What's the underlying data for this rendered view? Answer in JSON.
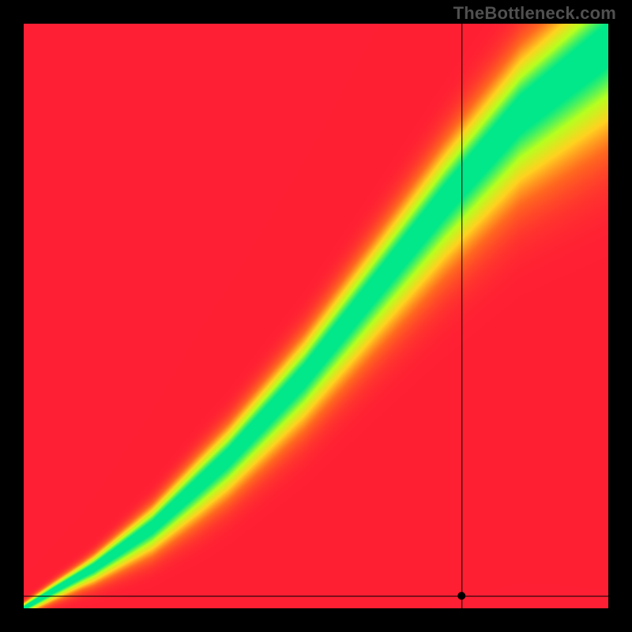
{
  "attribution": "TheBottleneck.com",
  "chart_data": {
    "type": "heatmap",
    "title": "",
    "xlabel": "",
    "ylabel": "",
    "xlim": [
      0,
      1
    ],
    "ylim": [
      0,
      1
    ],
    "crosshair": {
      "x": 0.75,
      "y": 0.02
    },
    "colorscale": [
      {
        "t": 0.0,
        "hex": "#ff1f34"
      },
      {
        "t": 0.25,
        "hex": "#ff6a1f"
      },
      {
        "t": 0.5,
        "hex": "#ffd21f"
      },
      {
        "t": 0.75,
        "hex": "#b7ff1f"
      },
      {
        "t": 1.0,
        "hex": "#00e88a"
      }
    ],
    "ridge": {
      "type": "monotone-curve",
      "description": "Sharp diagonal green ridge from bottom-left corner to top-right, value≈1 on ridge, falls to 0 away from it",
      "control_points_xy": [
        [
          0.0,
          0.0
        ],
        [
          0.05,
          0.03
        ],
        [
          0.12,
          0.07
        ],
        [
          0.22,
          0.14
        ],
        [
          0.35,
          0.26
        ],
        [
          0.48,
          0.4
        ],
        [
          0.6,
          0.55
        ],
        [
          0.72,
          0.7
        ],
        [
          0.85,
          0.85
        ],
        [
          1.0,
          0.97
        ]
      ],
      "half_width_at": [
        [
          0.0,
          0.006
        ],
        [
          0.1,
          0.012
        ],
        [
          0.3,
          0.03
        ],
        [
          0.6,
          0.05
        ],
        [
          1.0,
          0.08
        ]
      ]
    },
    "crosshair_marker": {
      "shape": "dot",
      "radius_px": 5,
      "hex": "#000000"
    },
    "crosshair_lines": {
      "stroke_px": 1,
      "hex": "#000000"
    }
  }
}
